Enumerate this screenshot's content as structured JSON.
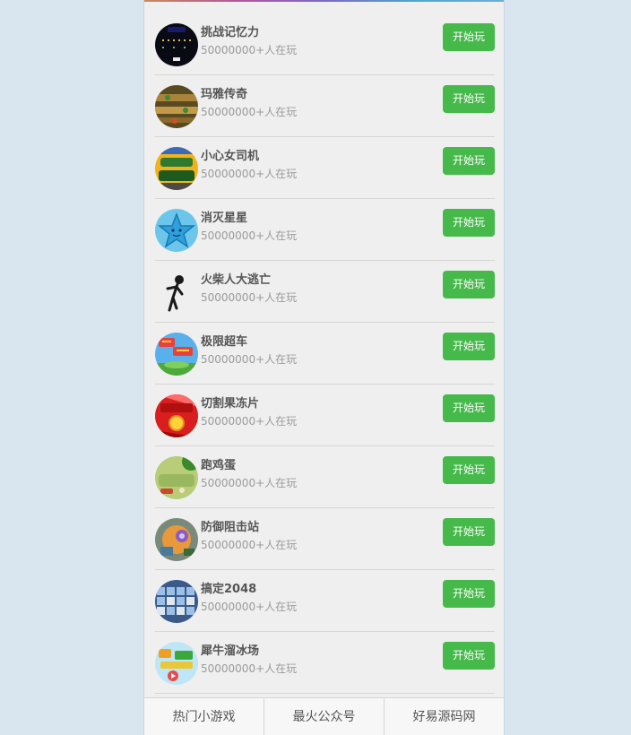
{
  "games": [
    {
      "icon": "memory-challenge-icon",
      "title": "挑战记忆力",
      "players": "50000000+人在玩",
      "button": "开始玩"
    },
    {
      "icon": "maya-legend-icon",
      "title": "玛雅传奇",
      "players": "50000000+人在玩",
      "button": "开始玩"
    },
    {
      "icon": "careful-driver-icon",
      "title": "小心女司机",
      "players": "50000000+人在玩",
      "button": "开始玩"
    },
    {
      "icon": "star-pop-icon",
      "title": "消灭星星",
      "players": "50000000+人在玩",
      "button": "开始玩"
    },
    {
      "icon": "stickman-escape-icon",
      "title": "火柴人大逃亡",
      "players": "50000000+人在玩",
      "button": "开始玩"
    },
    {
      "icon": "extreme-racing-icon",
      "title": "极限超车",
      "players": "50000000+人在玩",
      "button": "开始玩"
    },
    {
      "icon": "jelly-cut-icon",
      "title": "切割果冻片",
      "players": "50000000+人在玩",
      "button": "开始玩"
    },
    {
      "icon": "running-egg-icon",
      "title": "跑鸡蛋",
      "players": "50000000+人在玩",
      "button": "开始玩"
    },
    {
      "icon": "tower-defense-icon",
      "title": "防御阻击站",
      "players": "50000000+人在玩",
      "button": "开始玩"
    },
    {
      "icon": "game-2048-icon",
      "title": "搞定2048",
      "players": "50000000+人在玩",
      "button": "开始玩"
    },
    {
      "icon": "rhino-skating-icon",
      "title": "犀牛溜冰场",
      "players": "50000000+人在玩",
      "button": "开始玩"
    }
  ],
  "tabs": [
    {
      "label": "热门小游戏"
    },
    {
      "label": "最火公众号"
    },
    {
      "label": "好易源码网"
    }
  ],
  "colors": {
    "page_background": "#d9e6ef",
    "panel_background": "#efefef",
    "play_button": "#45b94a",
    "title_text": "#555555",
    "subtitle_text": "#9a9a9a"
  }
}
